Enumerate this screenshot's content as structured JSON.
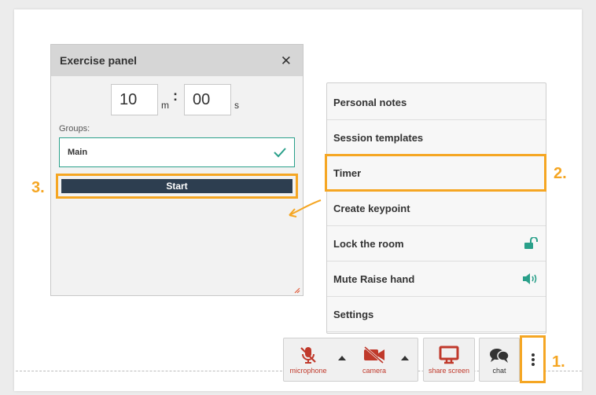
{
  "exercise_panel": {
    "title": "Exercise panel",
    "close_glyph": "✕",
    "minutes_value": "10",
    "minutes_unit": "m",
    "separator": ":",
    "seconds_value": "00",
    "seconds_unit": "s",
    "groups_label": "Groups:",
    "group_selected": "Main",
    "start_label": "Start"
  },
  "menu": {
    "items": [
      {
        "label": "Personal notes",
        "icon": ""
      },
      {
        "label": "Session templates",
        "icon": ""
      },
      {
        "label": "Timer",
        "icon": ""
      },
      {
        "label": "Create keypoint",
        "icon": ""
      },
      {
        "label": "Lock the room",
        "icon": "unlock-icon"
      },
      {
        "label": "Mute Raise hand",
        "icon": "volume-icon"
      },
      {
        "label": "Settings",
        "icon": ""
      }
    ]
  },
  "steps": {
    "one": "1.",
    "two": "2.",
    "three": "3."
  },
  "toolbar": {
    "microphone_label": "microphone",
    "camera_label": "camera",
    "share_screen_label": "share screen",
    "chat_label": "chat"
  },
  "colors": {
    "accent_orange": "#f5a623",
    "teal": "#2aa08a",
    "button_dark": "#2d3e50",
    "alert_red": "#c0392b"
  }
}
